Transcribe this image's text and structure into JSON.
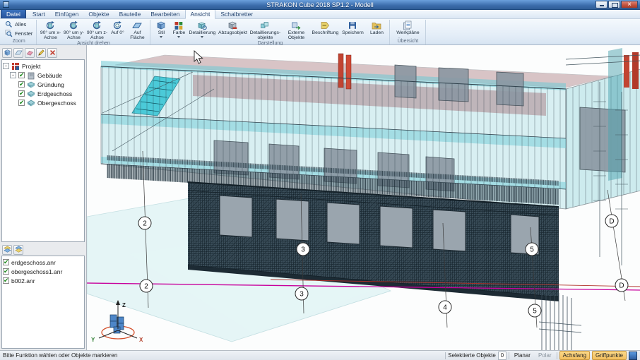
{
  "window": {
    "title": "STRAKON Cube 2018 SP1.2 - Modell"
  },
  "ribbon": {
    "tabs": [
      {
        "label": "Datei"
      },
      {
        "label": "Start"
      },
      {
        "label": "Einfügen"
      },
      {
        "label": "Objekte"
      },
      {
        "label": "Bauteile"
      },
      {
        "label": "Bearbeiten"
      },
      {
        "label": "Ansicht"
      },
      {
        "label": "Schalbretter"
      }
    ],
    "groups": [
      {
        "title": "Zoom",
        "buttons": [
          {
            "label": "Alles"
          },
          {
            "label": "Fenster"
          }
        ]
      },
      {
        "title": "Ansicht drehen",
        "buttons": [
          {
            "label": "90° um x-Achse"
          },
          {
            "label": "90° um y-Achse"
          },
          {
            "label": "90° um z-Achse"
          },
          {
            "label": "Auf 0°"
          },
          {
            "label": "Auf Fläche"
          }
        ]
      },
      {
        "title": "Darstellung",
        "buttons": [
          {
            "label": "Stil"
          },
          {
            "label": "Farbe"
          },
          {
            "label": "Detaillierung"
          },
          {
            "label": "Abzugsobjekt"
          },
          {
            "label": "Detaillierungs-objekte"
          },
          {
            "label": "Externe Objekte"
          },
          {
            "label": "Beschriftung"
          },
          {
            "label": "Speichern"
          },
          {
            "label": "Laden"
          }
        ]
      },
      {
        "title": "Übersicht",
        "buttons": [
          {
            "label": "Werkpläne"
          }
        ]
      }
    ]
  },
  "project_tree": {
    "root": "Projekt",
    "building": "Gebäude",
    "items": [
      "Gründung",
      "Erdgeschoss",
      "Obergeschoss"
    ]
  },
  "plan_list": {
    "items": [
      "erdgeschoss.anr",
      "obergeschoss1.anr",
      "b002.anr"
    ]
  },
  "viewport": {
    "grid_labels": {
      "two": "2",
      "three": "3",
      "four": "4",
      "five": "5",
      "d": "D"
    },
    "gizmo": {
      "z": "Z",
      "x": "X",
      "y": "Y"
    }
  },
  "status": {
    "hint": "Bitte Funktion wählen oder Objekte markieren",
    "selected_label": "Selektierte Objekte",
    "selected_count": "0",
    "planar": "Planar",
    "polar": "Polar",
    "achsfang": "Achsfang",
    "griffpunkte": "Griffpunkte"
  },
  "colors": {
    "accent": "#3b6cab",
    "highlight": "#f3bf5e",
    "teal": "#6fcbd6",
    "magenta": "#c8009c",
    "red": "#c14432"
  }
}
